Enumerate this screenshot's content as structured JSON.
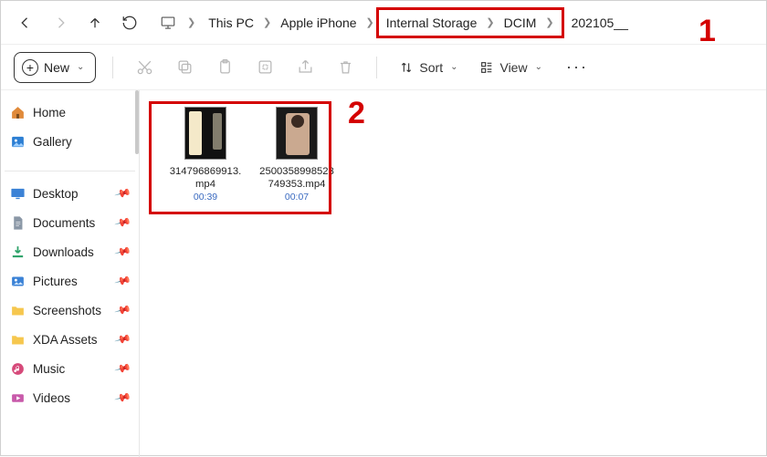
{
  "breadcrumb": {
    "items": [
      "This PC",
      "Apple iPhone",
      "Internal Storage",
      "DCIM",
      "202105__"
    ]
  },
  "toolbar": {
    "new_label": "New",
    "sort_label": "Sort",
    "view_label": "View"
  },
  "sidebar": {
    "top": [
      {
        "label": "Home"
      },
      {
        "label": "Gallery"
      }
    ],
    "pinned": [
      {
        "label": "Desktop"
      },
      {
        "label": "Documents"
      },
      {
        "label": "Downloads"
      },
      {
        "label": "Pictures"
      },
      {
        "label": "Screenshots"
      },
      {
        "label": "XDA Assets"
      },
      {
        "label": "Music"
      },
      {
        "label": "Videos"
      }
    ]
  },
  "files": [
    {
      "name": "314796869913.mp4",
      "duration": "00:39"
    },
    {
      "name": "2500358998523749353.mp4",
      "duration": "00:07"
    }
  ],
  "annotations": {
    "a1": "1",
    "a2": "2"
  }
}
